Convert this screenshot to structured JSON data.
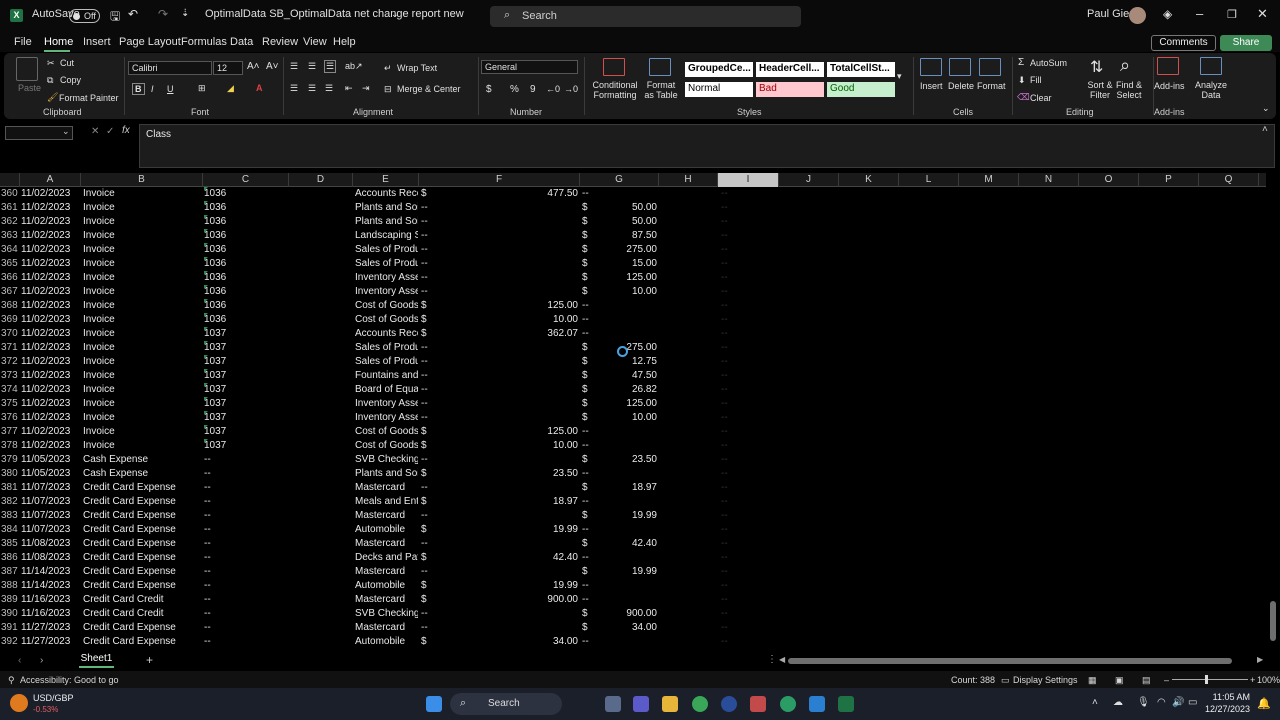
{
  "titlebar": {
    "autosave_label": "AutoSave",
    "autosave_state": "Off",
    "file_title": "OptimalData SB_OptimalData net change report new",
    "search_placeholder": "Search",
    "user_name": "Paul Giese"
  },
  "menu": {
    "items": [
      "File",
      "Home",
      "Insert",
      "Page Layout",
      "Formulas",
      "Data",
      "Review",
      "View",
      "Help"
    ],
    "active": "Home",
    "comments_label": "Comments",
    "share_label": "Share"
  },
  "ribbon": {
    "clipboard": {
      "paste": "Paste",
      "cut": "Cut",
      "copy": "Copy",
      "format_painter": "Format Painter",
      "group": "Clipboard"
    },
    "font": {
      "name": "Calibri",
      "size": "12",
      "group": "Font"
    },
    "alignment": {
      "wrap_text": "Wrap Text",
      "merge_center": "Merge & Center",
      "group": "Alignment"
    },
    "number": {
      "format": "General",
      "group": "Number"
    },
    "styles": {
      "conditional_formatting": "Conditional Formatting",
      "format_as_table": "Format as Table",
      "cells": [
        "GroupedCe...",
        "HeaderCell...",
        "TotalCellSt...",
        "Normal",
        "Bad",
        "Good"
      ],
      "group": "Styles"
    },
    "cells": {
      "insert": "Insert",
      "delete": "Delete",
      "format": "Format",
      "group": "Cells"
    },
    "editing": {
      "autosum": "AutoSum",
      "fill": "Fill",
      "clear": "Clear",
      "sort_filter": "Sort & Filter",
      "find_select": "Find & Select",
      "group": "Editing"
    },
    "addins": {
      "addins": "Add-ins",
      "analyze": "Analyze Data",
      "group": "Add-ins"
    }
  },
  "formula_bar": {
    "name_box": "",
    "content": "Class"
  },
  "columns": [
    "A",
    "B",
    "C",
    "D",
    "E",
    "F",
    "G",
    "H",
    "I",
    "J",
    "K",
    "L",
    "M",
    "N",
    "O",
    "P",
    "Q"
  ],
  "selected_column": "I",
  "rows": [
    {
      "n": "360",
      "a": "11/02/2023",
      "b": "Invoice",
      "c": "1036",
      "e": "Accounts Rece",
      "f$": "$",
      "f": "477.50",
      "g$": "",
      "g": "",
      "fd": "--",
      "i": "--"
    },
    {
      "n": "361",
      "a": "11/02/2023",
      "b": "Invoice",
      "c": "1036",
      "e": "Plants and Soil",
      "f$": "",
      "f": "",
      "g$": "$",
      "g": "50.00",
      "fd": "--",
      "i": "--"
    },
    {
      "n": "362",
      "a": "11/02/2023",
      "b": "Invoice",
      "c": "1036",
      "e": "Plants and Soil",
      "f$": "",
      "f": "",
      "g$": "$",
      "g": "50.00",
      "fd": "--",
      "i": "--"
    },
    {
      "n": "363",
      "a": "11/02/2023",
      "b": "Invoice",
      "c": "1036",
      "e": "Landscaping S",
      "f$": "",
      "f": "",
      "g$": "$",
      "g": "87.50",
      "fd": "--",
      "i": "--"
    },
    {
      "n": "364",
      "a": "11/02/2023",
      "b": "Invoice",
      "c": "1036",
      "e": "Sales of Produ",
      "f$": "",
      "f": "",
      "g$": "$",
      "g": "275.00",
      "fd": "--",
      "i": "--"
    },
    {
      "n": "365",
      "a": "11/02/2023",
      "b": "Invoice",
      "c": "1036",
      "e": "Sales of Produ",
      "f$": "",
      "f": "",
      "g$": "$",
      "g": "15.00",
      "fd": "--",
      "i": "--"
    },
    {
      "n": "366",
      "a": "11/02/2023",
      "b": "Invoice",
      "c": "1036",
      "e": "Inventory Asse",
      "f$": "",
      "f": "",
      "g$": "$",
      "g": "125.00",
      "fd": "--",
      "i": "--"
    },
    {
      "n": "367",
      "a": "11/02/2023",
      "b": "Invoice",
      "c": "1036",
      "e": "Inventory Asse",
      "f$": "",
      "f": "",
      "g$": "$",
      "g": "10.00",
      "fd": "--",
      "i": "--"
    },
    {
      "n": "368",
      "a": "11/02/2023",
      "b": "Invoice",
      "c": "1036",
      "e": "Cost of Goods",
      "f$": "$",
      "f": "125.00",
      "g$": "",
      "g": "",
      "fd": "--",
      "i": "--"
    },
    {
      "n": "369",
      "a": "11/02/2023",
      "b": "Invoice",
      "c": "1036",
      "e": "Cost of Goods",
      "f$": "$",
      "f": "10.00",
      "g$": "",
      "g": "",
      "fd": "--",
      "i": "--"
    },
    {
      "n": "370",
      "a": "11/02/2023",
      "b": "Invoice",
      "c": "1037",
      "e": "Accounts Rece",
      "f$": "$",
      "f": "362.07",
      "g$": "",
      "g": "",
      "fd": "--",
      "i": "--"
    },
    {
      "n": "371",
      "a": "11/02/2023",
      "b": "Invoice",
      "c": "1037",
      "e": "Sales of Produ",
      "f$": "",
      "f": "",
      "g$": "$",
      "g": "275.00",
      "fd": "--",
      "i": "--"
    },
    {
      "n": "372",
      "a": "11/02/2023",
      "b": "Invoice",
      "c": "1037",
      "e": "Sales of Produ",
      "f$": "",
      "f": "",
      "g$": "$",
      "g": "12.75",
      "fd": "--",
      "i": "--"
    },
    {
      "n": "373",
      "a": "11/02/2023",
      "b": "Invoice",
      "c": "1037",
      "e": "Fountains and",
      "f$": "",
      "f": "",
      "g$": "$",
      "g": "47.50",
      "fd": "--",
      "i": "--"
    },
    {
      "n": "374",
      "a": "11/02/2023",
      "b": "Invoice",
      "c": "1037",
      "e": "Board of Equal",
      "f$": "",
      "f": "",
      "g$": "$",
      "g": "26.82",
      "fd": "--",
      "i": "--"
    },
    {
      "n": "375",
      "a": "11/02/2023",
      "b": "Invoice",
      "c": "1037",
      "e": "Inventory Asse",
      "f$": "",
      "f": "",
      "g$": "$",
      "g": "125.00",
      "fd": "--",
      "i": "--"
    },
    {
      "n": "376",
      "a": "11/02/2023",
      "b": "Invoice",
      "c": "1037",
      "e": "Inventory Asse",
      "f$": "",
      "f": "",
      "g$": "$",
      "g": "10.00",
      "fd": "--",
      "i": "--"
    },
    {
      "n": "377",
      "a": "11/02/2023",
      "b": "Invoice",
      "c": "1037",
      "e": "Cost of Goods",
      "f$": "$",
      "f": "125.00",
      "g$": "",
      "g": "",
      "fd": "--",
      "i": "--"
    },
    {
      "n": "378",
      "a": "11/02/2023",
      "b": "Invoice",
      "c": "1037",
      "e": "Cost of Goods",
      "f$": "$",
      "f": "10.00",
      "g$": "",
      "g": "",
      "fd": "--",
      "i": "--"
    },
    {
      "n": "379",
      "a": "11/05/2023",
      "b": "Cash Expense",
      "c": "--",
      "e": "SVB Checking",
      "f$": "",
      "f": "",
      "g$": "$",
      "g": "23.50",
      "fd": "--",
      "i": "--"
    },
    {
      "n": "380",
      "a": "11/05/2023",
      "b": "Cash Expense",
      "c": "--",
      "e": "Plants and Soil",
      "f$": "$",
      "f": "23.50",
      "g$": "",
      "g": "",
      "fd": "--",
      "i": "--"
    },
    {
      "n": "381",
      "a": "11/07/2023",
      "b": "Credit Card Expense",
      "c": "--",
      "e": "Mastercard",
      "f$": "",
      "f": "",
      "g$": "$",
      "g": "18.97",
      "fd": "--",
      "i": "--"
    },
    {
      "n": "382",
      "a": "11/07/2023",
      "b": "Credit Card Expense",
      "c": "--",
      "e": "Meals and Ent",
      "f$": "$",
      "f": "18.97",
      "g$": "",
      "g": "",
      "fd": "--",
      "i": "--"
    },
    {
      "n": "383",
      "a": "11/07/2023",
      "b": "Credit Card Expense",
      "c": "--",
      "e": "Mastercard",
      "f$": "",
      "f": "",
      "g$": "$",
      "g": "19.99",
      "fd": "--",
      "i": "--"
    },
    {
      "n": "384",
      "a": "11/07/2023",
      "b": "Credit Card Expense",
      "c": "--",
      "e": "Automobile",
      "f$": "$",
      "f": "19.99",
      "g$": "",
      "g": "",
      "fd": "--",
      "i": "--"
    },
    {
      "n": "385",
      "a": "11/08/2023",
      "b": "Credit Card Expense",
      "c": "--",
      "e": "Mastercard",
      "f$": "",
      "f": "",
      "g$": "$",
      "g": "42.40",
      "fd": "--",
      "i": "--"
    },
    {
      "n": "386",
      "a": "11/08/2023",
      "b": "Credit Card Expense",
      "c": "--",
      "e": "Decks and Pati",
      "f$": "$",
      "f": "42.40",
      "g$": "",
      "g": "",
      "fd": "--",
      "i": "--"
    },
    {
      "n": "387",
      "a": "11/14/2023",
      "b": "Credit Card Expense",
      "c": "--",
      "e": "Mastercard",
      "f$": "",
      "f": "",
      "g$": "$",
      "g": "19.99",
      "fd": "--",
      "i": "--"
    },
    {
      "n": "388",
      "a": "11/14/2023",
      "b": "Credit Card Expense",
      "c": "--",
      "e": "Automobile",
      "f$": "$",
      "f": "19.99",
      "g$": "",
      "g": "",
      "fd": "--",
      "i": "--"
    },
    {
      "n": "389",
      "a": "11/16/2023",
      "b": "Credit Card Credit",
      "c": "--",
      "e": "Mastercard",
      "f$": "$",
      "f": "900.00",
      "g$": "",
      "g": "",
      "fd": "--",
      "i": "--"
    },
    {
      "n": "390",
      "a": "11/16/2023",
      "b": "Credit Card Credit",
      "c": "--",
      "e": "SVB Checking",
      "f$": "",
      "f": "",
      "g$": "$",
      "g": "900.00",
      "fd": "--",
      "i": "--"
    },
    {
      "n": "391",
      "a": "11/27/2023",
      "b": "Credit Card Expense",
      "c": "--",
      "e": "Mastercard",
      "f$": "",
      "f": "",
      "g$": "$",
      "g": "34.00",
      "fd": "--",
      "i": "--"
    },
    {
      "n": "392",
      "a": "11/27/2023",
      "b": "Credit Card Expense",
      "c": "--",
      "e": "Automobile",
      "f$": "$",
      "f": "34.00",
      "g$": "",
      "g": "",
      "fd": "--",
      "i": "--"
    }
  ],
  "sheets": {
    "tabs": [
      "Sheet1"
    ],
    "active": "Sheet1"
  },
  "statusbar": {
    "accessibility": "Accessibility: Good to go",
    "count": "Count: 388",
    "display_settings": "Display Settings",
    "zoom": "100%"
  },
  "taskbar": {
    "ticker_name": "USD/GBP",
    "ticker_change": "-0.53%",
    "search_label": "Search",
    "time": "11:05 AM",
    "date": "12/27/2023"
  },
  "colors": {
    "accent_green": "#3d8a56",
    "selected_column": "#c6c6c6",
    "bad_bg": "#ffc7ce",
    "good_bg": "#c6efce"
  }
}
